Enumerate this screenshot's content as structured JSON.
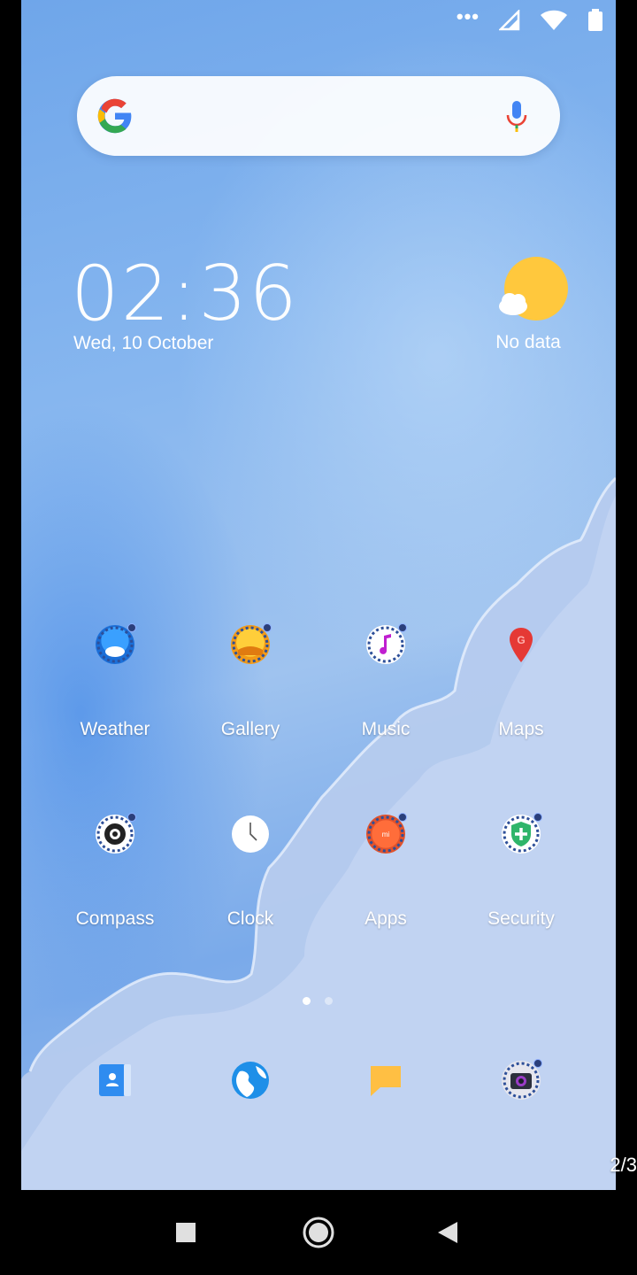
{
  "status_bar": {
    "icons": [
      "more-dots-icon",
      "signal-icon",
      "wifi-icon",
      "battery-icon"
    ]
  },
  "search_bar": {
    "logo": "google-logo-icon",
    "mic": "mic-icon",
    "placeholder": ""
  },
  "clock_widget": {
    "time": "02:36",
    "date": "Wed, 10 October"
  },
  "weather_widget": {
    "icon": "sun-cloud-icon",
    "status": "No data"
  },
  "apps": [
    {
      "label": "Weather",
      "icon": "weather-icon"
    },
    {
      "label": "Gallery",
      "icon": "gallery-icon"
    },
    {
      "label": "Music",
      "icon": "music-icon"
    },
    {
      "label": "Maps",
      "icon": "maps-pin-icon"
    },
    {
      "label": "Compass",
      "icon": "compass-icon"
    },
    {
      "label": "Clock",
      "icon": "clock-icon"
    },
    {
      "label": "Apps",
      "icon": "mi-apps-icon"
    },
    {
      "label": "Security",
      "icon": "security-shield-icon"
    }
  ],
  "page_dots": {
    "count": 2,
    "active": 0
  },
  "dock": [
    {
      "icon": "contacts-icon"
    },
    {
      "icon": "browser-globe-icon"
    },
    {
      "icon": "messages-icon"
    },
    {
      "icon": "camera-icon"
    }
  ],
  "page_indicator": "2/3",
  "nav_bar": {
    "icons": [
      "recents-square-icon",
      "home-circle-icon",
      "back-triangle-icon"
    ]
  },
  "colors": {
    "wallpaper_blue": "#7aaaea",
    "wave_light": "#b7cdf0",
    "weather_sun": "#ffc83d",
    "maps_red": "#e53935",
    "security_green": "#2fb56a"
  }
}
